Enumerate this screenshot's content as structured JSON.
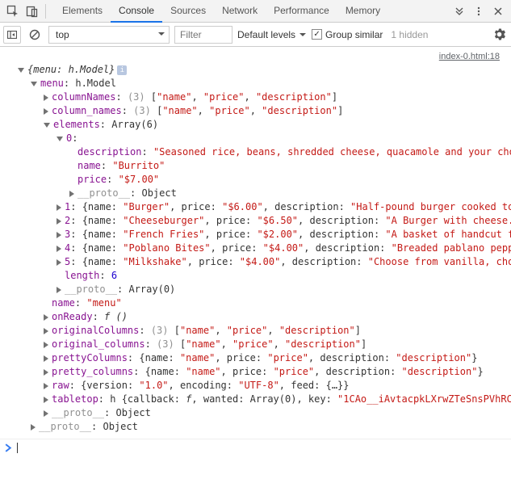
{
  "tabs": {
    "elements": "Elements",
    "console": "Console",
    "sources": "Sources",
    "network": "Network",
    "performance": "Performance",
    "memory": "Memory"
  },
  "subbar": {
    "context": "top",
    "filter_placeholder": "Filter",
    "levels": "Default levels",
    "group_similar": "Group similar",
    "hidden": "1 hidden"
  },
  "filelink": "index-0.html:18",
  "log": {
    "root": "{menu: h.Model}",
    "menu_label": "menu",
    "menu_type": "h.Model",
    "col_array_label": "(3)",
    "col_names": "[\"name\", \"price\", \"description\"]",
    "columnNames_key": "columnNames",
    "column_names_key": "column_names",
    "elements_key": "elements",
    "elements_type": "Array(6)",
    "idx0": "0",
    "idx0_desc_key": "description",
    "idx0_desc_val": "\"Seasoned rice, beans, shredded cheese, quacamole and your cho",
    "idx0_name_key": "name",
    "idx0_name_val": "\"Burrito\"",
    "idx0_price_key": "price",
    "idx0_price_val": "\"$7.00\"",
    "proto_key": "__proto__",
    "proto_obj": "Object",
    "proto_arr": "Array(0)",
    "idx1": "1",
    "idx1_body": "{name: \"Burger\", price: \"$6.00\", description: \"Half-pound burger cooked to",
    "idx2": "2",
    "idx2_body": "{name: \"Cheeseburger\", price: \"$6.50\", description: \"A Burger with cheese.",
    "idx3": "3",
    "idx3_body": "{name: \"French Fries\", price: \"$2.00\", description: \"A basket of handcut f",
    "idx4": "4",
    "idx4_body": "{name: \"Poblano Bites\", price: \"$4.00\", description: \"Breaded pablano pepp",
    "idx5": "5",
    "idx5_body": "{name: \"Milkshake\", price: \"$4.00\", description: \"Choose from vanilla, cho",
    "length_key": "length",
    "length_val": "6",
    "name_key": "name",
    "name_val": "\"menu\"",
    "onReady_key": "onReady",
    "onReady_val": "f ()",
    "originalColumns_key": "originalColumns",
    "original_columns_key": "original_columns",
    "prettyColumns_key": "prettyColumns",
    "pretty_obj": "{name: \"name\", price: \"price\", description: \"description\"}",
    "pretty_columns_key": "pretty_columns",
    "raw_key": "raw",
    "raw_val": "{version: \"1.0\", encoding: \"UTF-8\", feed: {…}}",
    "tabletop_key": "tabletop",
    "tabletop_val_pre": "h ",
    "tabletop_val": "{callback: f, wanted: Array(0), key: \"1CAo__iAvtacpkLXrwZTeSnsPVhRC"
  },
  "inline": {
    "name_k": "name",
    "price_k": "price",
    "desc_k": "description",
    "version_k": "version",
    "encoding_k": "encoding",
    "feed_k": "feed",
    "callback_k": "callback",
    "wanted_k": "wanted",
    "key_k": "key"
  }
}
